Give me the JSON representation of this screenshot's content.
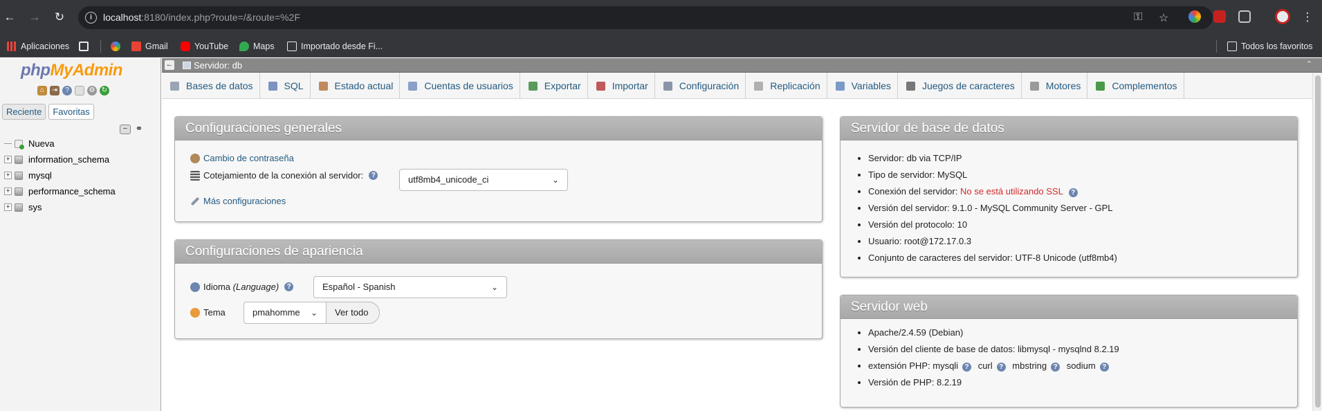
{
  "browser": {
    "url_host": "localhost",
    "url_rest": ":8180/index.php?route=/&route=%2F",
    "bookmarks": [
      {
        "label": "Aplicaciones",
        "color": "#e8453c"
      },
      {
        "label": "Gmail",
        "color": "#ea4335"
      },
      {
        "label": "YouTube",
        "color": "#ff0000"
      },
      {
        "label": "Maps",
        "color": "#34a853"
      },
      {
        "label": "Importado desde Fi...",
        "color": "#9aa0a6"
      }
    ],
    "all_bookmarks": "Todos los favoritos"
  },
  "logo": {
    "php": "php",
    "myadmin": "MyAdmin"
  },
  "nav": {
    "tabs": [
      "Reciente",
      "Favoritas"
    ],
    "new_label": "Nueva",
    "databases": [
      "information_schema",
      "mysql",
      "performance_schema",
      "sys"
    ]
  },
  "serverbar": {
    "label": "Servidor: db"
  },
  "menu": [
    {
      "label": "Bases de datos",
      "name": "databases",
      "color": "#9aa4b4"
    },
    {
      "label": "SQL",
      "name": "sql",
      "color": "#7a93c0"
    },
    {
      "label": "Estado actual",
      "name": "status",
      "color": "#c08b5c"
    },
    {
      "label": "Cuentas de usuarios",
      "name": "user-accounts",
      "color": "#8aa0c8"
    },
    {
      "label": "Exportar",
      "name": "export",
      "color": "#5a9a5a"
    },
    {
      "label": "Importar",
      "name": "import",
      "color": "#c05a5a"
    },
    {
      "label": "Configuración",
      "name": "settings",
      "color": "#8a95a8"
    },
    {
      "label": "Replicación",
      "name": "replication",
      "color": "#b0b0b0"
    },
    {
      "label": "Variables",
      "name": "variables",
      "color": "#7a9ac8"
    },
    {
      "label": "Juegos de caracteres",
      "name": "charsets",
      "color": "#777777"
    },
    {
      "label": "Motores",
      "name": "engines",
      "color": "#9a9a9a"
    },
    {
      "label": "Complementos",
      "name": "plugins",
      "color": "#4a9a4a"
    }
  ],
  "general": {
    "title": "Configuraciones generales",
    "change_password": "Cambio de contraseña",
    "collation_label": "Cotejamiento de la conexión al servidor:",
    "collation_value": "utf8mb4_unicode_ci",
    "more_settings": "Más configuraciones"
  },
  "appearance": {
    "title": "Configuraciones de apariencia",
    "language_label": "Idioma",
    "language_hint": "(Language)",
    "language_value": "Español - Spanish",
    "theme_label": "Tema",
    "theme_value": "pmahomme",
    "view_all": "Ver todo"
  },
  "db_server": {
    "title": "Servidor de base de datos",
    "items": [
      "Servidor: db via TCP/IP",
      "Tipo de servidor: MySQL",
      "Conexión del servidor: ",
      "Versión del servidor: 9.1.0 - MySQL Community Server - GPL",
      "Versión del protocolo: 10",
      "Usuario: root@172.17.0.3",
      "Conjunto de caracteres del servidor: UTF-8 Unicode (utf8mb4)"
    ],
    "ssl_warning": "No se está utilizando SSL"
  },
  "web_server": {
    "title": "Servidor web",
    "apache": "Apache/2.4.59 (Debian)",
    "client": "Versión del cliente de base de datos: libmysql - mysqlnd 8.2.19",
    "php_ext_label": "extensión PHP:",
    "php_exts": [
      "mysqli",
      "curl",
      "mbstring",
      "sodium"
    ],
    "php_version": "Versión de PHP: 8.2.19"
  }
}
